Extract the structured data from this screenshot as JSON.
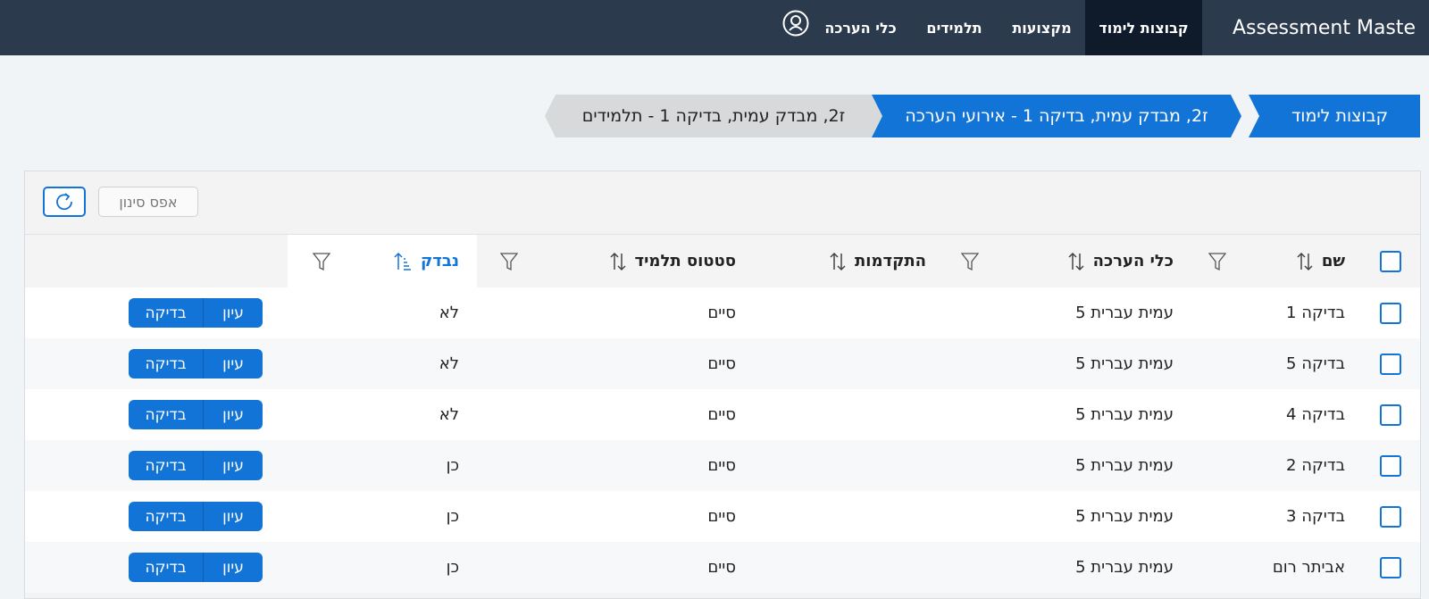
{
  "nav": {
    "brand": "Assessment Maste",
    "items": [
      {
        "label": "קבוצות לימוד",
        "active": true
      },
      {
        "label": "מקצועות",
        "active": false
      },
      {
        "label": "תלמידים",
        "active": false
      },
      {
        "label": "כלי הערכה",
        "active": false
      }
    ],
    "user_icon": "user-circle-icon"
  },
  "breadcrumbs": [
    {
      "label": "קבוצות לימוד"
    },
    {
      "label": "ז2, מבדק עמית, בדיקה 1 - אירועי הערכה"
    },
    {
      "label": "ז2, מבדק עמית, בדיקה 1 - תלמידים"
    }
  ],
  "toolbar": {
    "reset_filter_label": "אפס סינון",
    "refresh_icon": "refresh-icon"
  },
  "table": {
    "headers": {
      "name": "שם",
      "tool": "כלי הערכה",
      "progress": "התקדמות",
      "status": "סטטוס תלמיד",
      "checked": "נבדק"
    },
    "sorted_column": "checked",
    "rows": [
      {
        "name": "בדיקה 1",
        "tool": "עמית עברית 5",
        "progress": "",
        "status": "סיים",
        "checked": "לא",
        "view_label": "עיון",
        "check_label": "בדיקה"
      },
      {
        "name": "בדיקה 5",
        "tool": "עמית עברית 5",
        "progress": "",
        "status": "סיים",
        "checked": "לא",
        "view_label": "עיון",
        "check_label": "בדיקה"
      },
      {
        "name": "בדיקה 4",
        "tool": "עמית עברית 5",
        "progress": "",
        "status": "סיים",
        "checked": "לא",
        "view_label": "עיון",
        "check_label": "בדיקה"
      },
      {
        "name": "בדיקה 2",
        "tool": "עמית עברית 5",
        "progress": "",
        "status": "סיים",
        "checked": "כן",
        "view_label": "עיון",
        "check_label": "בדיקה"
      },
      {
        "name": "בדיקה 3",
        "tool": "עמית עברית 5",
        "progress": "",
        "status": "סיים",
        "checked": "כן",
        "view_label": "עיון",
        "check_label": "בדיקה"
      },
      {
        "name": "אביתר רום",
        "tool": "עמית עברית 5",
        "progress": "",
        "status": "סיים",
        "checked": "כן",
        "view_label": "עיון",
        "check_label": "בדיקה"
      }
    ]
  },
  "colors": {
    "nav_bg": "#2c3a4e",
    "nav_active": "#0f1a2b",
    "accent": "#1374d8",
    "crumb_grey": "#d7d9db"
  }
}
